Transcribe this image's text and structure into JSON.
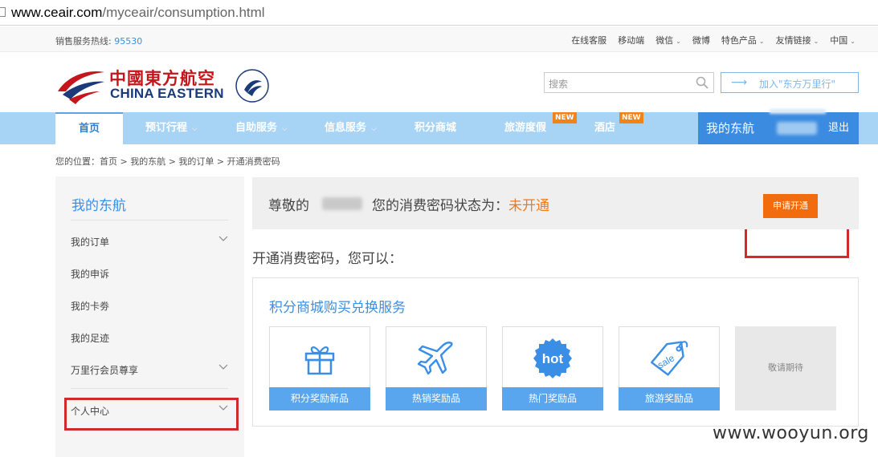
{
  "browser": {
    "url_host": "www.ceair.com",
    "url_path": "/myceair/consumption.html"
  },
  "topbar": {
    "hotline_label": "销售服务热线:",
    "hotline_number": "95530",
    "links": [
      {
        "label": "在线客服",
        "caret": false
      },
      {
        "label": "移动端",
        "caret": false
      },
      {
        "label": "微信",
        "caret": true
      },
      {
        "label": "微博",
        "caret": false
      },
      {
        "label": "特色产品",
        "caret": true
      },
      {
        "label": "友情链接",
        "caret": true
      },
      {
        "label": "中国",
        "caret": true
      }
    ]
  },
  "logo": {
    "cn": "中國東方航空",
    "en": "CHINA EASTERN"
  },
  "search": {
    "placeholder": "搜索",
    "icon": "search-icon"
  },
  "join_button": {
    "label": "加入\"东方万里行\"",
    "icon": "arrow-right-icon"
  },
  "nav": {
    "home": "首页",
    "items": [
      {
        "label": "预订行程",
        "caret": true
      },
      {
        "label": "自助服务",
        "caret": true
      },
      {
        "label": "信息服务",
        "caret": true
      },
      {
        "label": "积分商城",
        "caret": false
      },
      {
        "label": "旅游度假",
        "caret": false,
        "badge": "NEW"
      },
      {
        "label": "酒店",
        "caret": false,
        "badge": "NEW"
      }
    ],
    "my": "我的东航",
    "logout": "退出"
  },
  "breadcrumb": "您的位置：首页 > 我的东航 > 我的订单 > 开通消费密码",
  "sidebar": {
    "title": "我的东航",
    "items": [
      {
        "label": "我的订单",
        "expandable": true
      },
      {
        "label": "我的申诉",
        "expandable": false
      },
      {
        "label": "我的卡劵",
        "expandable": false
      },
      {
        "label": "我的足迹",
        "expandable": false
      },
      {
        "label": "万里行会员尊享",
        "expandable": true
      },
      {
        "label": "个人中心",
        "expandable": true
      }
    ]
  },
  "status": {
    "prefix": "尊敬的",
    "middle": "您的消费密码状态为：",
    "value": "未开通",
    "value_color": "#f07a1a"
  },
  "apply_button": "申请开通",
  "subheading": "开通消费密码，您可以：",
  "services": {
    "title": "积分商城购买兑换服务",
    "cards": [
      {
        "label": "积分奖励新品",
        "icon": "gift-icon"
      },
      {
        "label": "热销奖励品",
        "icon": "airplane-icon"
      },
      {
        "label": "热门奖励品",
        "icon": "hot-badge-icon",
        "icon_text": "hot"
      },
      {
        "label": "旅游奖励品",
        "icon": "sale-tag-icon",
        "icon_text": "sale"
      }
    ],
    "coming_soon": "敬请期待"
  },
  "watermark": "www.wooyun.org",
  "colors": {
    "brand_blue": "#3a8ee6",
    "nav_bg": "#a7d3f5",
    "accent_orange": "#f26c0e",
    "highlight_red": "#d22a2a"
  }
}
